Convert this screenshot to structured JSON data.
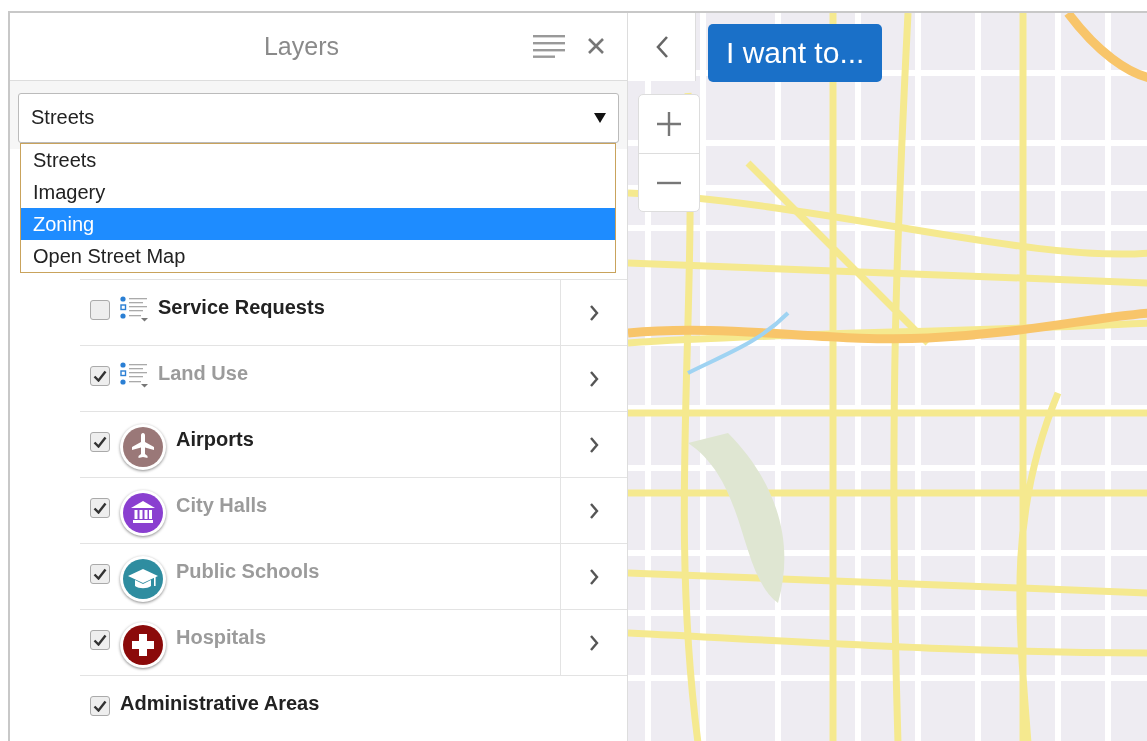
{
  "panel": {
    "title": "Layers"
  },
  "basemap_select": {
    "value": "Streets",
    "options": [
      {
        "label": "Streets",
        "highlighted": false
      },
      {
        "label": "Imagery",
        "highlighted": false
      },
      {
        "label": "Zoning",
        "highlighted": true
      },
      {
        "label": "Open Street Map",
        "highlighted": false
      }
    ]
  },
  "layers": [
    {
      "name": "Service Requests",
      "checked": false,
      "dimmed": false,
      "kind": "legend"
    },
    {
      "name": "Land Use",
      "checked": true,
      "dimmed": true,
      "kind": "legend"
    },
    {
      "name": "Airports",
      "checked": true,
      "dimmed": false,
      "kind": "airport",
      "color": "#9a7878"
    },
    {
      "name": "City Halls",
      "checked": true,
      "dimmed": true,
      "kind": "cityhall",
      "color": "#8a3fd0"
    },
    {
      "name": "Public Schools",
      "checked": true,
      "dimmed": true,
      "kind": "school",
      "color": "#2f8da0"
    },
    {
      "name": "Hospitals",
      "checked": true,
      "dimmed": true,
      "kind": "hospital",
      "color": "#8b0a0a"
    },
    {
      "name": "Administrative Areas",
      "checked": true,
      "dimmed": false,
      "kind": "group"
    }
  ],
  "map": {
    "action_button": "I want to..."
  }
}
